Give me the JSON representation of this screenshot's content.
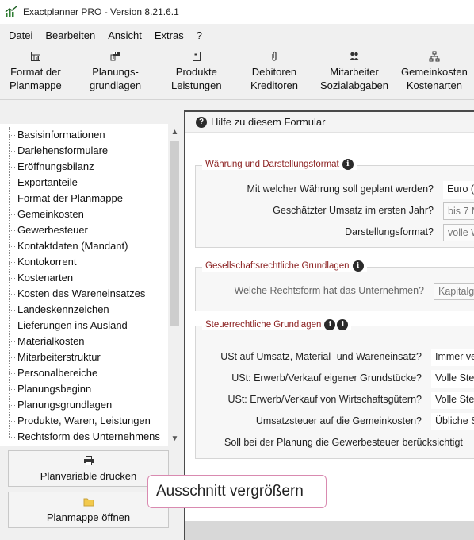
{
  "window": {
    "title": "Exactplanner PRO - Version 8.21.6.1"
  },
  "menu": [
    "Datei",
    "Bearbeiten",
    "Ansicht",
    "Extras",
    "?"
  ],
  "toolbar": [
    {
      "line1": "Format der",
      "line2": "Planmappe",
      "icon": "spreadsheet-icon"
    },
    {
      "line1": "Planungs-",
      "line2": "grundlagen",
      "icon": "planning-icon"
    },
    {
      "line1": "Produkte",
      "line2": "Leistungen",
      "icon": "document-icon"
    },
    {
      "line1": "Debitoren",
      "line2": "Kreditoren",
      "icon": "paperclip-icon"
    },
    {
      "line1": "Mitarbeiter",
      "line2": "Sozialabgaben",
      "icon": "people-icon"
    },
    {
      "line1": "Gemeinkosten",
      "line2": "Kostenarten",
      "icon": "org-chart-icon"
    }
  ],
  "tree": [
    "Basisinformationen",
    "Darlehensformulare",
    "Eröffnungsbilanz",
    "Exportanteile",
    "Format der Planmappe",
    "Gemeinkosten",
    "Gewerbesteuer",
    "Kontaktdaten (Mandant)",
    "Kontokorrent",
    "Kostenarten",
    "Kosten des Wareneinsatzes",
    "Landeskennzeichen",
    "Lieferungen ins Ausland",
    "Materialkosten",
    "Mitarbeiterstruktur",
    "Personalbereiche",
    "Planungsbeginn",
    "Planungsgrundlagen",
    "Produkte, Waren, Leistungen",
    "Rechtsform des Unternehmens"
  ],
  "sidebar_buttons": {
    "print": "Planvariable drucken",
    "open": "Planmappe öffnen"
  },
  "tooltip": "Ausschnitt vergrößern",
  "form": {
    "help": "Hilfe zu diesem Formular",
    "group1": {
      "title": "Währung und Darstellungsformat",
      "q1": "Mit welcher Währung soll geplant werden?",
      "a1": "Euro (",
      "q2": "Geschätzter Umsatz im ersten Jahr?",
      "a2": "bis 7 M",
      "q3": "Darstellungsformat?",
      "a3": "volle W"
    },
    "group2": {
      "title": "Gesellschaftsrechtliche Grundlagen",
      "q1": "Welche Rechtsform hat das Unternehmen?",
      "a1": "Kapitalg"
    },
    "group3": {
      "title": "Steuerrechtliche Grundlagen",
      "q1": "USt auf Umsatz, Material- und Wareneinsatz?",
      "a1": "Immer ve",
      "q2": "USt: Erwerb/Verkauf eigener Grundstücke?",
      "a2": "Volle Ste",
      "q3": "USt: Erwerb/Verkauf von Wirtschaftsgütern?",
      "a3": "Volle Ste",
      "q4": "Umsatzsteuer auf die Gemeinkosten?",
      "a4": "Übliche S",
      "q5": "Soll bei der Planung die Gewerbesteuer berücksichtigt"
    }
  }
}
